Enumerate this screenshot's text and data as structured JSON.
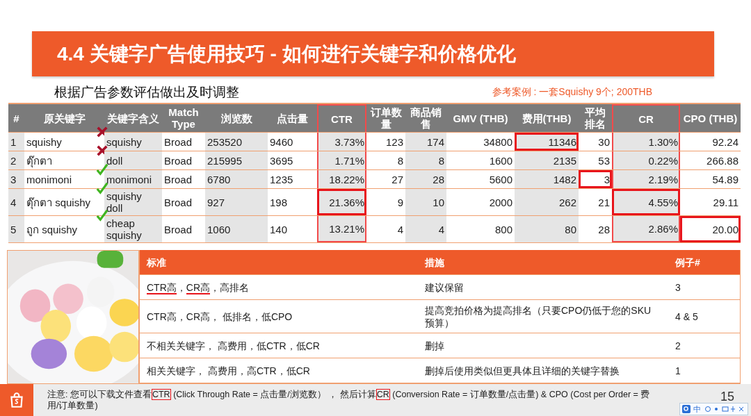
{
  "title": "4.4 关键字广告使用技巧 - 如何进行关键字和价格优化",
  "subtitle": "根据广告参数评估做出及时调整",
  "reference": "参考案例 : 一套Squishy 9个; 200THB",
  "keyword_table": {
    "columns": [
      {
        "label": "#",
        "outlined": false
      },
      {
        "label": "原关键字",
        "outlined": false
      },
      {
        "label": "关键字含义",
        "outlined": false
      },
      {
        "label": "Match Type",
        "outlined": false
      },
      {
        "label": "浏览数",
        "outlined": false
      },
      {
        "label": "点击量",
        "outlined": false
      },
      {
        "label": "CTR",
        "outlined": true
      },
      {
        "label": "订单数量",
        "outlined": false
      },
      {
        "label": "商品销售",
        "outlined": false
      },
      {
        "label": "GMV (THB)",
        "outlined": false
      },
      {
        "label": "费用(THB)",
        "outlined": false
      },
      {
        "label": "平均排名",
        "outlined": false
      },
      {
        "label": "CR",
        "outlined": true
      },
      {
        "label": "CPO (THB)",
        "outlined": false
      }
    ],
    "rows": [
      {
        "kind": "cross",
        "cells": [
          {
            "text": "1",
            "highlighted": false
          },
          {
            "text": "squishy",
            "highlighted": false
          },
          {
            "text": "squishy",
            "highlighted": false
          },
          {
            "text": "Broad",
            "highlighted": false
          },
          {
            "text": "253520",
            "highlighted": false
          },
          {
            "text": "9460",
            "highlighted": false
          },
          {
            "text": "3.73%",
            "highlighted": false
          },
          {
            "text": "123",
            "highlighted": false
          },
          {
            "text": "174",
            "highlighted": false
          },
          {
            "text": "34800",
            "highlighted": false
          },
          {
            "text": "11346",
            "highlighted": true
          },
          {
            "text": "30",
            "highlighted": false
          },
          {
            "text": "1.30%",
            "highlighted": false
          },
          {
            "text": "92.24",
            "highlighted": false
          }
        ]
      },
      {
        "kind": "cross",
        "cells": [
          {
            "text": "2",
            "highlighted": false
          },
          {
            "text": "ตุ๊กตา",
            "highlighted": false
          },
          {
            "text": "doll",
            "highlighted": false
          },
          {
            "text": "Broad",
            "highlighted": false
          },
          {
            "text": "215995",
            "highlighted": false
          },
          {
            "text": "3695",
            "highlighted": false
          },
          {
            "text": "1.71%",
            "highlighted": false
          },
          {
            "text": "8",
            "highlighted": false
          },
          {
            "text": "8",
            "highlighted": false
          },
          {
            "text": "1600",
            "highlighted": false
          },
          {
            "text": "2135",
            "highlighted": false
          },
          {
            "text": "53",
            "highlighted": false
          },
          {
            "text": "0.22%",
            "highlighted": false
          },
          {
            "text": "266.88",
            "highlighted": false
          }
        ]
      },
      {
        "kind": "check",
        "cells": [
          {
            "text": "3",
            "highlighted": false
          },
          {
            "text": "monimoni",
            "highlighted": false
          },
          {
            "text": "monimoni",
            "highlighted": false
          },
          {
            "text": "Broad",
            "highlighted": false
          },
          {
            "text": "6780",
            "highlighted": false
          },
          {
            "text": "1235",
            "highlighted": false
          },
          {
            "text": "18.22%",
            "highlighted": false
          },
          {
            "text": "27",
            "highlighted": false
          },
          {
            "text": "28",
            "highlighted": false
          },
          {
            "text": "5600",
            "highlighted": false
          },
          {
            "text": "1482",
            "highlighted": false
          },
          {
            "text": "3",
            "highlighted": true
          },
          {
            "text": "2.19%",
            "highlighted": false
          },
          {
            "text": "54.89",
            "highlighted": false
          }
        ]
      },
      {
        "kind": "check",
        "cells": [
          {
            "text": "4",
            "highlighted": false
          },
          {
            "text": "ตุ๊กตา squishy",
            "highlighted": false
          },
          {
            "text": "squishy doll",
            "highlighted": false
          },
          {
            "text": "Broad",
            "highlighted": false
          },
          {
            "text": "927",
            "highlighted": false
          },
          {
            "text": "198",
            "highlighted": false
          },
          {
            "text": "21.36%",
            "highlighted": true
          },
          {
            "text": "9",
            "highlighted": false
          },
          {
            "text": "10",
            "highlighted": false
          },
          {
            "text": "2000",
            "highlighted": false
          },
          {
            "text": "262",
            "highlighted": false
          },
          {
            "text": "21",
            "highlighted": false
          },
          {
            "text": "4.55%",
            "highlighted": true
          },
          {
            "text": "29.11",
            "highlighted": false
          }
        ]
      },
      {
        "kind": "check",
        "cells": [
          {
            "text": "5",
            "highlighted": false
          },
          {
            "text": "ถูก squishy",
            "highlighted": false
          },
          {
            "text": "cheap squishy",
            "highlighted": false
          },
          {
            "text": "Broad",
            "highlighted": false
          },
          {
            "text": "1060",
            "highlighted": false
          },
          {
            "text": "140",
            "highlighted": false
          },
          {
            "text": "13.21%",
            "highlighted": false
          },
          {
            "text": "4",
            "highlighted": false
          },
          {
            "text": "4",
            "highlighted": false
          },
          {
            "text": "800",
            "highlighted": false
          },
          {
            "text": "80",
            "highlighted": false
          },
          {
            "text": "28",
            "highlighted": false
          },
          {
            "text": "2.86%",
            "highlighted": false
          },
          {
            "text": "20.00",
            "highlighted": true
          }
        ]
      }
    ]
  },
  "rules_table": {
    "columns": [
      "标准",
      "措施",
      "例子#"
    ],
    "rows": [
      {
        "criteria": [
          {
            "text": "CTR高",
            "underlined": true,
            "after": "，"
          },
          {
            "text": "CR高",
            "underlined": true
          },
          {
            "text": "，高排名",
            "underlined": false
          }
        ],
        "action": "建议保留",
        "example": "3"
      },
      {
        "criteria": [
          {
            "text": "CTR高，CR高， 低排名，低CPO",
            "underlined": false
          }
        ],
        "action": "提高竞拍价格为提高排名（只要CPO仍低于您的SKU预算）",
        "example": "4 & 5"
      },
      {
        "criteria": [
          {
            "text": "不相关关键字， 高费用，低CTR，低CR",
            "underlined": false
          }
        ],
        "action": "删掉",
        "example": "2"
      },
      {
        "criteria": [
          {
            "text": "相关关键字， 高费用，高CTR，低CR",
            "underlined": false
          }
        ],
        "action": "删掉后使用类似但更具体且详细的关键字替换",
        "example": "1"
      }
    ]
  },
  "footnote": [
    {
      "text": "注意: 您可以下载文件查看",
      "boxed": false
    },
    {
      "text": "CTR",
      "boxed": true
    },
    {
      "text": " (Click Through Rate = 点击量/浏览数） ， 然后计算",
      "boxed": false
    },
    {
      "text": "CR",
      "boxed": true
    },
    {
      "text": " (Conversion Rate = 订单数量/点击量) & CPO (Cost per Order = 费用/订单数量)",
      "boxed": false
    }
  ],
  "page_number": "15",
  "ime_toolbar": {
    "label": "中"
  }
}
